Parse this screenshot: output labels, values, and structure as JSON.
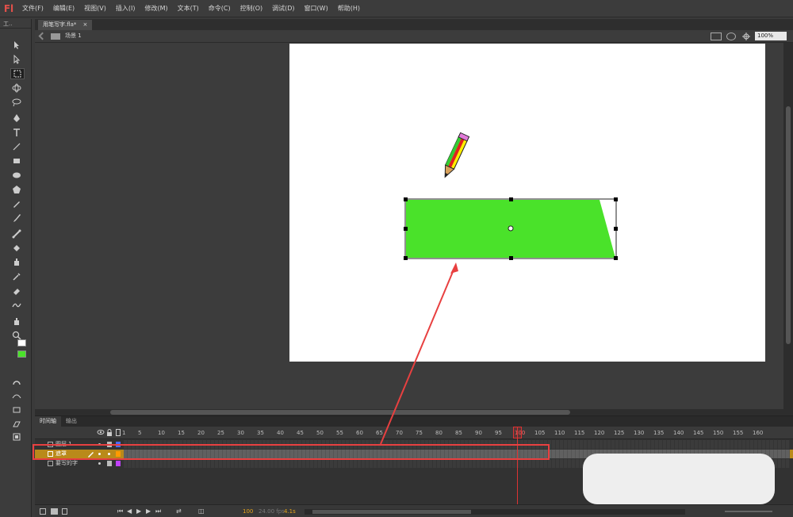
{
  "app": {
    "logo": "Fl"
  },
  "menu": [
    "文件(F)",
    "编辑(E)",
    "视图(V)",
    "插入(I)",
    "修改(M)",
    "文本(T)",
    "命令(C)",
    "控制(O)",
    "调试(D)",
    "窗口(W)",
    "帮助(H)"
  ],
  "tools_header": "工..",
  "document": {
    "tab_title": "用笔写字.fla*",
    "close_glyph": "×",
    "scene": "场景 1",
    "zoom": "100%"
  },
  "timeline": {
    "tabs": [
      "时间轴",
      "输出"
    ],
    "frame_numbers": [
      "1",
      "5",
      "10",
      "15",
      "20",
      "25",
      "30",
      "35",
      "40",
      "45",
      "50",
      "55",
      "60",
      "65",
      "70",
      "75",
      "80",
      "85",
      "90",
      "95",
      "100",
      "105",
      "110",
      "115",
      "120",
      "125",
      "130",
      "135",
      "140",
      "145",
      "150",
      "155",
      "160"
    ],
    "layers": [
      {
        "name": "图层 1",
        "selected": false
      },
      {
        "name": "遮罩",
        "selected": true
      },
      {
        "name": "要写的字",
        "selected": false
      }
    ],
    "footer": {
      "current_frame": "100",
      "fps": "24.00 fps",
      "time": "4.1s"
    }
  },
  "colors": {
    "accent": "#b98a1a",
    "shape_fill": "#4ae22a",
    "annotation": "#e84040"
  }
}
